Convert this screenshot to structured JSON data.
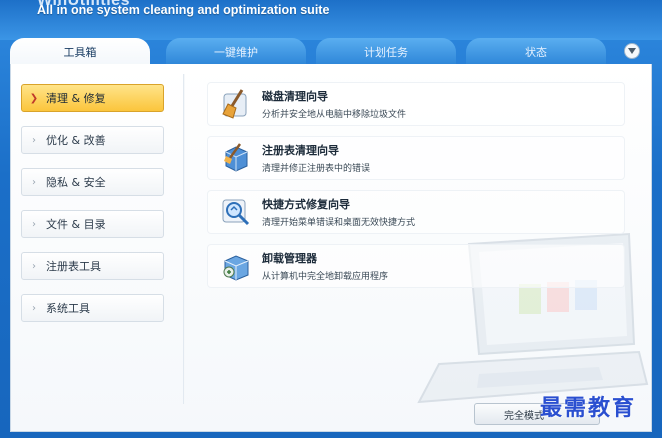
{
  "header": {
    "title": "WinUtilities",
    "subtitle": "All in one system cleaning and optimization suite"
  },
  "tabs": [
    {
      "label": "工具箱",
      "active": true
    },
    {
      "label": "一键维护",
      "active": false
    },
    {
      "label": "计划任务",
      "active": false
    },
    {
      "label": "状态",
      "active": false
    }
  ],
  "sidebar": {
    "items": [
      {
        "label": "清理 & 修复",
        "active": true
      },
      {
        "label": "优化 & 改善",
        "active": false
      },
      {
        "label": "隐私 & 安全",
        "active": false
      },
      {
        "label": "文件 & 目录",
        "active": false
      },
      {
        "label": "注册表工具",
        "active": false
      },
      {
        "label": "系统工具",
        "active": false
      }
    ]
  },
  "tools": [
    {
      "title": "磁盘清理向导",
      "desc": "分析并安全地从电脑中移除垃圾文件",
      "icon": "broom-icon"
    },
    {
      "title": "注册表清理向导",
      "desc": "清理并修正注册表中的错误",
      "icon": "registry-cube-icon"
    },
    {
      "title": "快捷方式修复向导",
      "desc": "清理开始菜单错误和桌面无效快捷方式",
      "icon": "magnifier-shortcut-icon"
    },
    {
      "title": "卸载管理器",
      "desc": "从计算机中完全地卸载应用程序",
      "icon": "uninstall-box-icon"
    }
  ],
  "footer": {
    "button_label": "完全模式"
  },
  "watermark": "最需教育",
  "colors": {
    "frame_blue": "#1b6fc8",
    "active_tab": "#ffffff",
    "active_side": "#fbc53c",
    "accent_red": "#c0392b"
  }
}
